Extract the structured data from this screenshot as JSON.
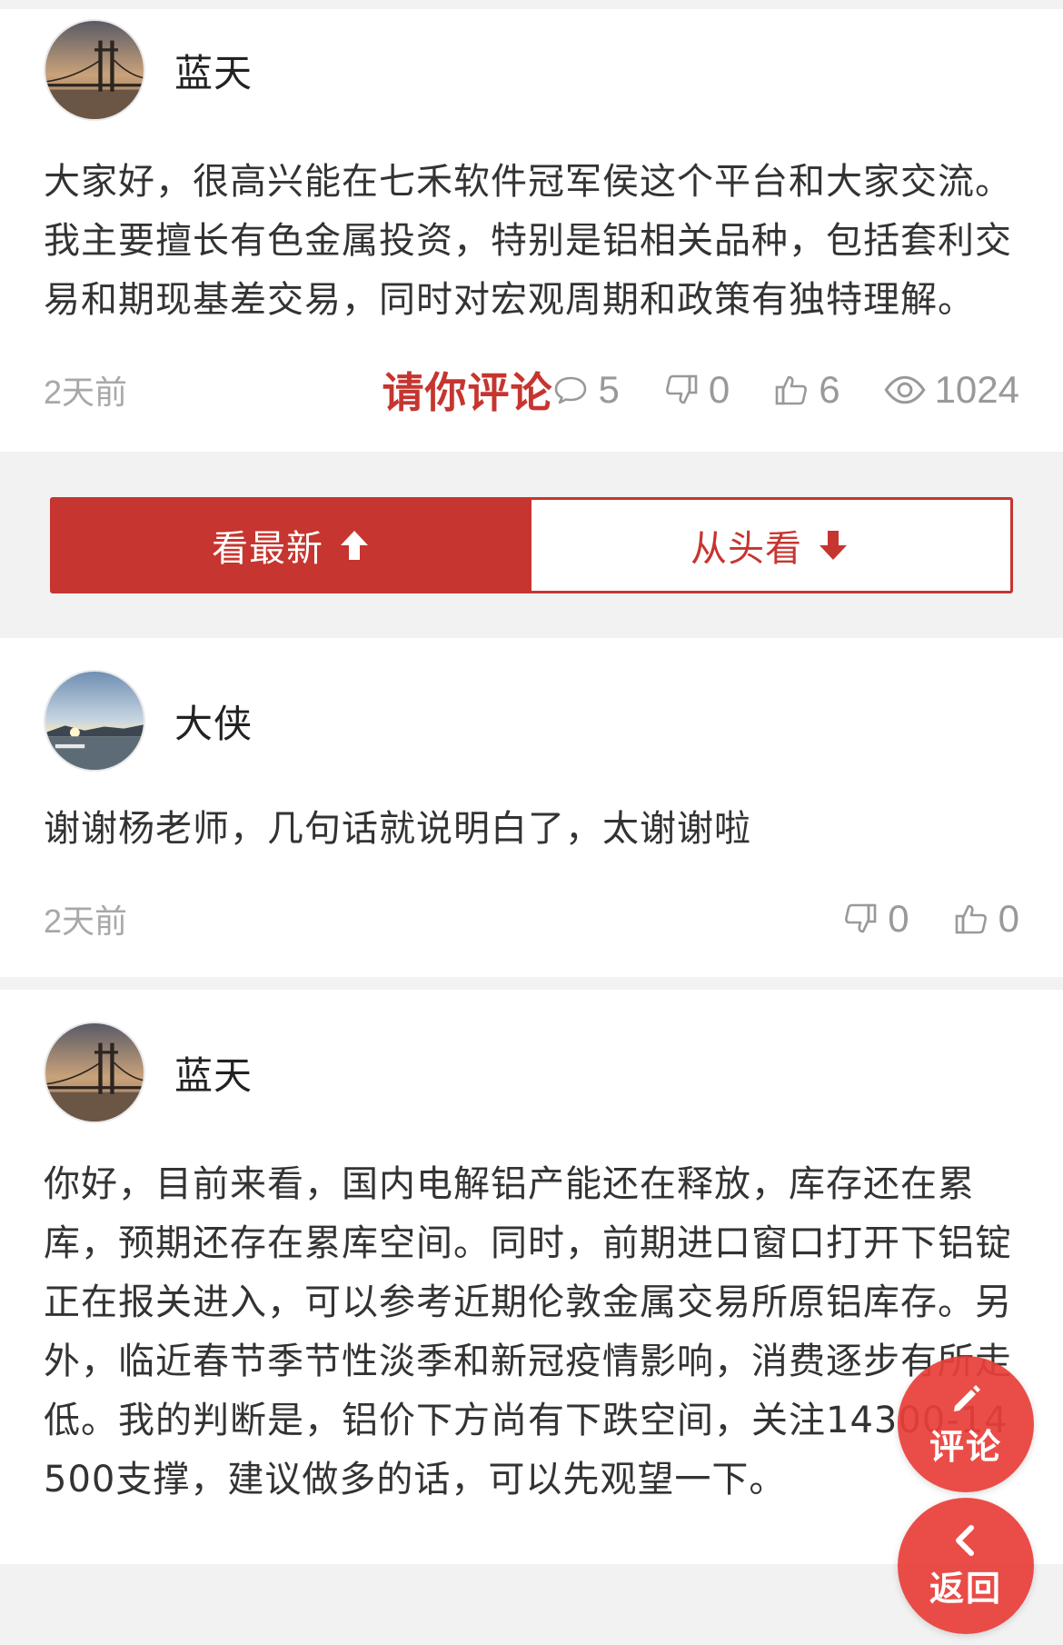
{
  "comments": [
    {
      "username": "蓝天",
      "content": "大家好，很高兴能在七禾软件冠军侯这个平台和大家交流。我主要擅长有色金属投资，特别是铝相关品种，包括套利交易和期现基差交易，同时对宏观周期和政策有独特理解。",
      "time": "2天前",
      "invite_label": "请你评论",
      "reply_count": "5",
      "dislike_count": "0",
      "like_count": "6",
      "view_count": "1024"
    },
    {
      "username": "大侠",
      "content": "谢谢杨老师，几句话就说明白了，太谢谢啦",
      "time": "2天前",
      "dislike_count": "0",
      "like_count": "0"
    },
    {
      "username": "蓝天",
      "content": "你好，目前来看，国内电解铝产能还在释放，库存还在累库，预期还存在累库空间。同时，前期进口窗口打开下铝锭正在报关进入，可以参考近期伦敦金属交易所原铝库存。另外，临近春节季节性淡季和新冠疫情影响，消费逐步有所走低。我的判断是，铝价下方尚有下跌空间，关注14300-14500支撑，建议做多的话，可以先观望一下。"
    }
  ],
  "sort": {
    "latest_label": "看最新",
    "oldest_label": "从头看"
  },
  "fab": {
    "comment_label": "评论",
    "back_label": "返回"
  },
  "colors": {
    "accent": "#c6352f",
    "fab": "#e8403a"
  },
  "icons": {
    "reply": "speech-bubble-icon",
    "dislike": "thumbs-down-icon",
    "like": "thumbs-up-icon",
    "views": "eye-icon",
    "arrow_up": "arrow-up-icon",
    "arrow_down": "arrow-down-icon",
    "edit": "pencil-icon",
    "back": "chevron-left-icon"
  }
}
